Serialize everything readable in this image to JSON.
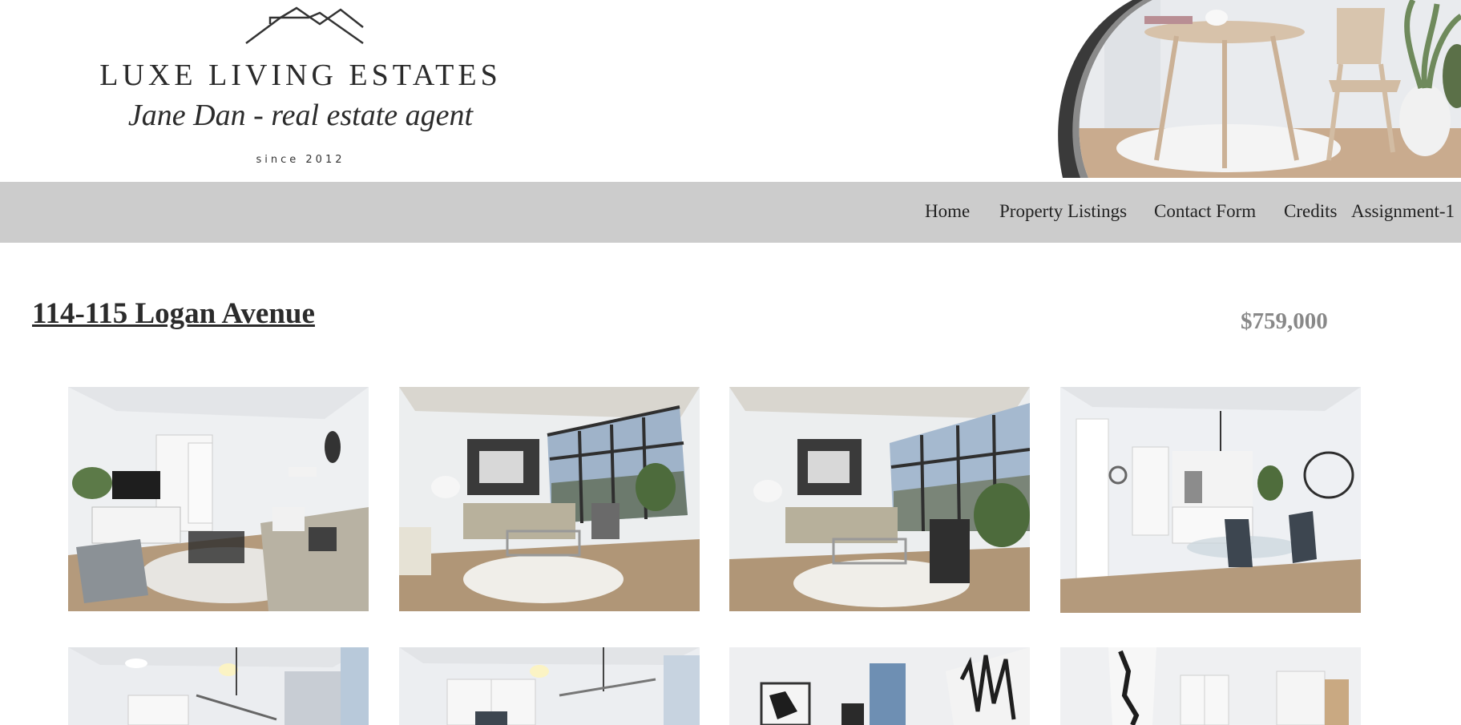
{
  "header": {
    "brand": "LUXE LIVING ESTATES",
    "agent": "Jane Dan - real estate agent",
    "since": "since 2012",
    "hero_image": "dining-table-chair-photo"
  },
  "nav": {
    "items": [
      {
        "label": "Home"
      },
      {
        "label": "Property Listings"
      },
      {
        "label": "Contact Form"
      },
      {
        "label": "Credits"
      },
      {
        "label": "Assignment-1"
      }
    ]
  },
  "listing": {
    "address": "114-115 Logan Avenue",
    "price": "$759,000",
    "photos": [
      {
        "subject": "living-room-with-tv-and-sectional"
      },
      {
        "subject": "living-room-with-floor-to-ceiling-windows"
      },
      {
        "subject": "living-room-with-city-view"
      },
      {
        "subject": "dining-area-and-kitchen"
      },
      {
        "subject": "dining-room-with-pendant-light"
      },
      {
        "subject": "kitchen-with-pendant-light"
      },
      {
        "subject": "hallway-with-abstract-art"
      },
      {
        "subject": "entry-hallway"
      }
    ]
  },
  "colors": {
    "nav_bg": "#cccccc",
    "price": "#888888",
    "text": "#2b2b2b",
    "floor": "#b49a7c",
    "wall": "#eef0f2"
  }
}
